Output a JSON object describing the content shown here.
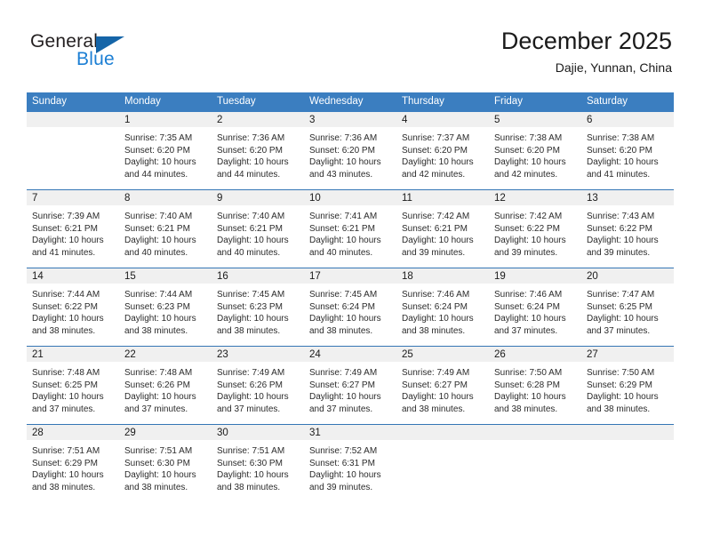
{
  "brand": {
    "name_top": "General",
    "name_bottom": "Blue",
    "triangle_color": "#1565a8",
    "blue_text_color": "#1c7fd4"
  },
  "header": {
    "title": "December 2025",
    "subtitle": "Dajie, Yunnan, China"
  },
  "theme": {
    "header_blue": "#3b7ec0",
    "row_line_blue": "#3576b5",
    "daynum_gray": "#f0f0f0"
  },
  "weekday_headers": [
    "Sunday",
    "Monday",
    "Tuesday",
    "Wednesday",
    "Thursday",
    "Friday",
    "Saturday"
  ],
  "weeks": [
    [
      {
        "day": "",
        "sunrise": "",
        "sunset": "",
        "daylight1": "",
        "daylight2": ""
      },
      {
        "day": "1",
        "sunrise": "Sunrise: 7:35 AM",
        "sunset": "Sunset: 6:20 PM",
        "daylight1": "Daylight: 10 hours",
        "daylight2": "and 44 minutes."
      },
      {
        "day": "2",
        "sunrise": "Sunrise: 7:36 AM",
        "sunset": "Sunset: 6:20 PM",
        "daylight1": "Daylight: 10 hours",
        "daylight2": "and 44 minutes."
      },
      {
        "day": "3",
        "sunrise": "Sunrise: 7:36 AM",
        "sunset": "Sunset: 6:20 PM",
        "daylight1": "Daylight: 10 hours",
        "daylight2": "and 43 minutes."
      },
      {
        "day": "4",
        "sunrise": "Sunrise: 7:37 AM",
        "sunset": "Sunset: 6:20 PM",
        "daylight1": "Daylight: 10 hours",
        "daylight2": "and 42 minutes."
      },
      {
        "day": "5",
        "sunrise": "Sunrise: 7:38 AM",
        "sunset": "Sunset: 6:20 PM",
        "daylight1": "Daylight: 10 hours",
        "daylight2": "and 42 minutes."
      },
      {
        "day": "6",
        "sunrise": "Sunrise: 7:38 AM",
        "sunset": "Sunset: 6:20 PM",
        "daylight1": "Daylight: 10 hours",
        "daylight2": "and 41 minutes."
      }
    ],
    [
      {
        "day": "7",
        "sunrise": "Sunrise: 7:39 AM",
        "sunset": "Sunset: 6:21 PM",
        "daylight1": "Daylight: 10 hours",
        "daylight2": "and 41 minutes."
      },
      {
        "day": "8",
        "sunrise": "Sunrise: 7:40 AM",
        "sunset": "Sunset: 6:21 PM",
        "daylight1": "Daylight: 10 hours",
        "daylight2": "and 40 minutes."
      },
      {
        "day": "9",
        "sunrise": "Sunrise: 7:40 AM",
        "sunset": "Sunset: 6:21 PM",
        "daylight1": "Daylight: 10 hours",
        "daylight2": "and 40 minutes."
      },
      {
        "day": "10",
        "sunrise": "Sunrise: 7:41 AM",
        "sunset": "Sunset: 6:21 PM",
        "daylight1": "Daylight: 10 hours",
        "daylight2": "and 40 minutes."
      },
      {
        "day": "11",
        "sunrise": "Sunrise: 7:42 AM",
        "sunset": "Sunset: 6:21 PM",
        "daylight1": "Daylight: 10 hours",
        "daylight2": "and 39 minutes."
      },
      {
        "day": "12",
        "sunrise": "Sunrise: 7:42 AM",
        "sunset": "Sunset: 6:22 PM",
        "daylight1": "Daylight: 10 hours",
        "daylight2": "and 39 minutes."
      },
      {
        "day": "13",
        "sunrise": "Sunrise: 7:43 AM",
        "sunset": "Sunset: 6:22 PM",
        "daylight1": "Daylight: 10 hours",
        "daylight2": "and 39 minutes."
      }
    ],
    [
      {
        "day": "14",
        "sunrise": "Sunrise: 7:44 AM",
        "sunset": "Sunset: 6:22 PM",
        "daylight1": "Daylight: 10 hours",
        "daylight2": "and 38 minutes."
      },
      {
        "day": "15",
        "sunrise": "Sunrise: 7:44 AM",
        "sunset": "Sunset: 6:23 PM",
        "daylight1": "Daylight: 10 hours",
        "daylight2": "and 38 minutes."
      },
      {
        "day": "16",
        "sunrise": "Sunrise: 7:45 AM",
        "sunset": "Sunset: 6:23 PM",
        "daylight1": "Daylight: 10 hours",
        "daylight2": "and 38 minutes."
      },
      {
        "day": "17",
        "sunrise": "Sunrise: 7:45 AM",
        "sunset": "Sunset: 6:24 PM",
        "daylight1": "Daylight: 10 hours",
        "daylight2": "and 38 minutes."
      },
      {
        "day": "18",
        "sunrise": "Sunrise: 7:46 AM",
        "sunset": "Sunset: 6:24 PM",
        "daylight1": "Daylight: 10 hours",
        "daylight2": "and 38 minutes."
      },
      {
        "day": "19",
        "sunrise": "Sunrise: 7:46 AM",
        "sunset": "Sunset: 6:24 PM",
        "daylight1": "Daylight: 10 hours",
        "daylight2": "and 37 minutes."
      },
      {
        "day": "20",
        "sunrise": "Sunrise: 7:47 AM",
        "sunset": "Sunset: 6:25 PM",
        "daylight1": "Daylight: 10 hours",
        "daylight2": "and 37 minutes."
      }
    ],
    [
      {
        "day": "21",
        "sunrise": "Sunrise: 7:48 AM",
        "sunset": "Sunset: 6:25 PM",
        "daylight1": "Daylight: 10 hours",
        "daylight2": "and 37 minutes."
      },
      {
        "day": "22",
        "sunrise": "Sunrise: 7:48 AM",
        "sunset": "Sunset: 6:26 PM",
        "daylight1": "Daylight: 10 hours",
        "daylight2": "and 37 minutes."
      },
      {
        "day": "23",
        "sunrise": "Sunrise: 7:49 AM",
        "sunset": "Sunset: 6:26 PM",
        "daylight1": "Daylight: 10 hours",
        "daylight2": "and 37 minutes."
      },
      {
        "day": "24",
        "sunrise": "Sunrise: 7:49 AM",
        "sunset": "Sunset: 6:27 PM",
        "daylight1": "Daylight: 10 hours",
        "daylight2": "and 37 minutes."
      },
      {
        "day": "25",
        "sunrise": "Sunrise: 7:49 AM",
        "sunset": "Sunset: 6:27 PM",
        "daylight1": "Daylight: 10 hours",
        "daylight2": "and 38 minutes."
      },
      {
        "day": "26",
        "sunrise": "Sunrise: 7:50 AM",
        "sunset": "Sunset: 6:28 PM",
        "daylight1": "Daylight: 10 hours",
        "daylight2": "and 38 minutes."
      },
      {
        "day": "27",
        "sunrise": "Sunrise: 7:50 AM",
        "sunset": "Sunset: 6:29 PM",
        "daylight1": "Daylight: 10 hours",
        "daylight2": "and 38 minutes."
      }
    ],
    [
      {
        "day": "28",
        "sunrise": "Sunrise: 7:51 AM",
        "sunset": "Sunset: 6:29 PM",
        "daylight1": "Daylight: 10 hours",
        "daylight2": "and 38 minutes."
      },
      {
        "day": "29",
        "sunrise": "Sunrise: 7:51 AM",
        "sunset": "Sunset: 6:30 PM",
        "daylight1": "Daylight: 10 hours",
        "daylight2": "and 38 minutes."
      },
      {
        "day": "30",
        "sunrise": "Sunrise: 7:51 AM",
        "sunset": "Sunset: 6:30 PM",
        "daylight1": "Daylight: 10 hours",
        "daylight2": "and 38 minutes."
      },
      {
        "day": "31",
        "sunrise": "Sunrise: 7:52 AM",
        "sunset": "Sunset: 6:31 PM",
        "daylight1": "Daylight: 10 hours",
        "daylight2": "and 39 minutes."
      },
      {
        "day": "",
        "sunrise": "",
        "sunset": "",
        "daylight1": "",
        "daylight2": ""
      },
      {
        "day": "",
        "sunrise": "",
        "sunset": "",
        "daylight1": "",
        "daylight2": ""
      },
      {
        "day": "",
        "sunrise": "",
        "sunset": "",
        "daylight1": "",
        "daylight2": ""
      }
    ]
  ]
}
